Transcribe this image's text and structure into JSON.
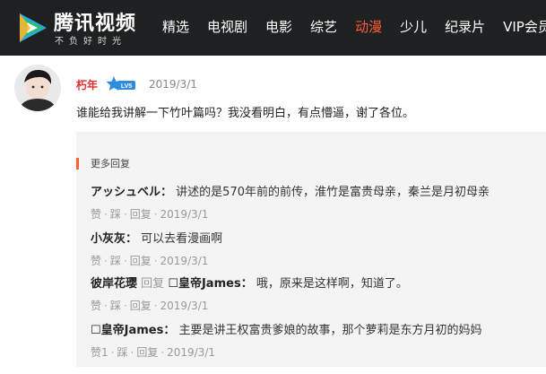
{
  "header": {
    "brand": "腾讯视频",
    "slogan": "不负好时光",
    "nav": [
      "精选",
      "电视剧",
      "电影",
      "综艺",
      "动漫",
      "少儿",
      "纪录片",
      "VIP会员"
    ],
    "active_nav": "动漫",
    "accent_color": "#ff5c38"
  },
  "comment": {
    "user": "朽年",
    "badge": "LV5",
    "date": "2019/3/1",
    "text": "谁能给我讲解一下竹叶篇吗？我没看明白，有点懵逼，谢了各位。"
  },
  "replies": {
    "title": "更多回复",
    "items": [
      {
        "name": "アッシュベル",
        "text": "讲述的是570年前的前传，淮竹是富贵母亲，秦兰是月初母亲",
        "like": "赞",
        "dislike": "踩",
        "reply": "回复",
        "date": "2019/3/1"
      },
      {
        "name": "小灰灰",
        "text": "可以去看漫画啊",
        "like": "赞",
        "dislike": "踩",
        "reply": "回复",
        "date": "2019/3/1"
      },
      {
        "name": "彼岸花璎",
        "reply_word": "回复",
        "target": "☐皇帝James",
        "text": "哦，原来是这样啊，知道了。",
        "like": "赞",
        "dislike": "踩",
        "reply": "回复",
        "date": "2019/3/1"
      },
      {
        "name": "☐皇帝James",
        "text": "主要是讲王权富贵爹娘的故事，那个萝莉是东方月初的妈妈",
        "like": "赞1",
        "dislike": "踩",
        "reply": "回复",
        "date": "2019/3/1"
      }
    ]
  }
}
